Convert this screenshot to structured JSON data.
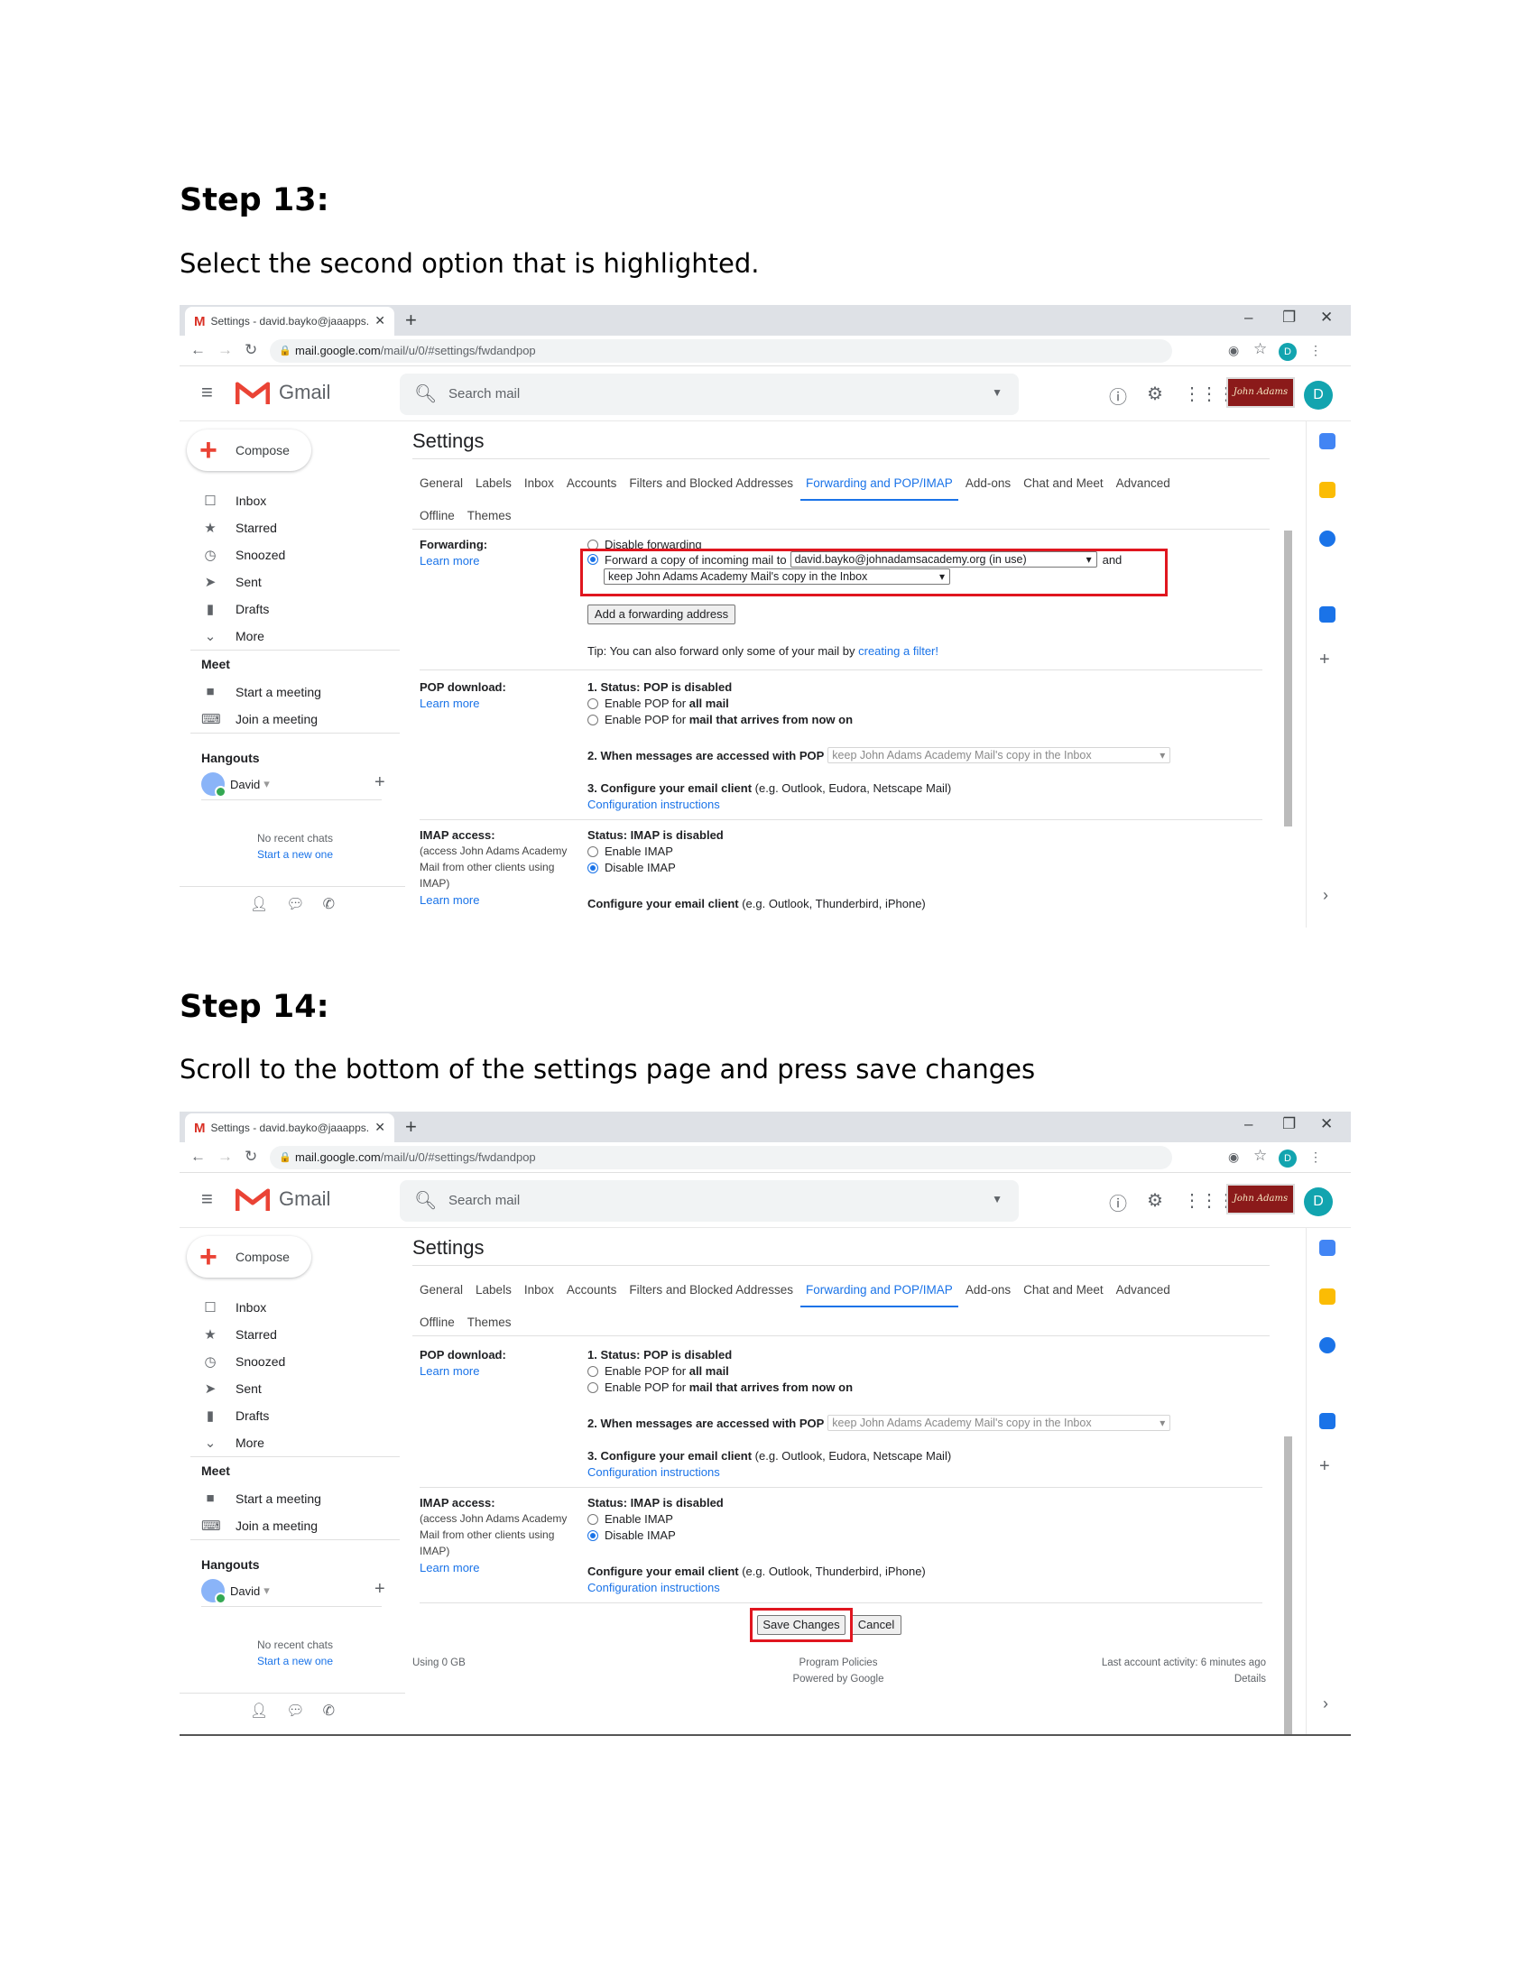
{
  "steps": [
    {
      "title": "Step 13:",
      "desc": "Select the second option that is highlighted."
    },
    {
      "title": "Step 14:",
      "desc": "Scroll to the bottom of the settings page and press save changes"
    }
  ],
  "browser": {
    "tab_title": "Settings - david.bayko@jaaapps.",
    "url_domain": "mail.google.com",
    "url_path": "/mail/u/0/#settings/fwdandpop",
    "avatar_letter": "D"
  },
  "gmail": {
    "logo_text": "Gmail",
    "search_placeholder": "Search mail",
    "brand_text": "John Adams",
    "avatar_letter": "D",
    "compose": "Compose",
    "nav": [
      "Inbox",
      "Starred",
      "Snoozed",
      "Sent",
      "Drafts",
      "More"
    ],
    "meet_heading": "Meet",
    "meet_items": [
      "Start a meeting",
      "Join a meeting"
    ],
    "hangouts_heading": "Hangouts",
    "hangouts_user": "David",
    "no_recent": "No recent chats",
    "start_new": "Start a new one"
  },
  "settings": {
    "title": "Settings",
    "tabs": [
      "General",
      "Labels",
      "Inbox",
      "Accounts",
      "Filters and Blocked Addresses",
      "Forwarding and POP/IMAP",
      "Add-ons",
      "Chat and Meet",
      "Advanced"
    ],
    "tabs_row2": [
      "Offline",
      "Themes"
    ],
    "learn_more": "Learn more",
    "forwarding": {
      "label": "Forwarding:",
      "disable": "Disable forwarding",
      "forward_prefix": "Forward a copy of incoming mail to",
      "forward_address": "david.bayko@johnadamsacademy.org (in use)",
      "and": "and",
      "keep_option": "keep John Adams Academy Mail's copy in the Inbox",
      "add_button": "Add a forwarding address",
      "tip_prefix": "Tip: You can also forward only some of your mail by",
      "tip_link": "creating a filter!"
    },
    "pop": {
      "label": "POP download:",
      "status": "1. Status: POP is disabled",
      "enable_all_prefix": "Enable POP for",
      "enable_all_bold": "all mail",
      "enable_now_prefix": "Enable POP for",
      "enable_now_bold": "mail that arrives from now on",
      "when_accessed": "2. When messages are accessed with POP",
      "when_option": "keep John Adams Academy Mail's copy in the Inbox",
      "configure_bold": "3. Configure your email client",
      "configure_rest": "(e.g. Outlook, Eudora, Netscape Mail)",
      "config_link": "Configuration instructions"
    },
    "imap": {
      "label": "IMAP access:",
      "desc": "(access John Adams Academy Mail from other clients using IMAP)",
      "status": "Status: IMAP is disabled",
      "enable": "Enable IMAP",
      "disable": "Disable IMAP",
      "configure_bold": "Configure your email client",
      "configure_rest": "(e.g. Outlook, Thunderbird, iPhone)",
      "config_link": "Configuration instructions"
    },
    "save_button": "Save Changes",
    "cancel_button": "Cancel",
    "footer": {
      "usage": "Using 0 GB",
      "policies": "Program Policies",
      "powered": "Powered by Google",
      "activity": "Last account activity: 6 minutes ago",
      "details": "Details"
    }
  },
  "colors": {
    "accent": "#1a73e8",
    "highlight_box": "#e0161f"
  }
}
